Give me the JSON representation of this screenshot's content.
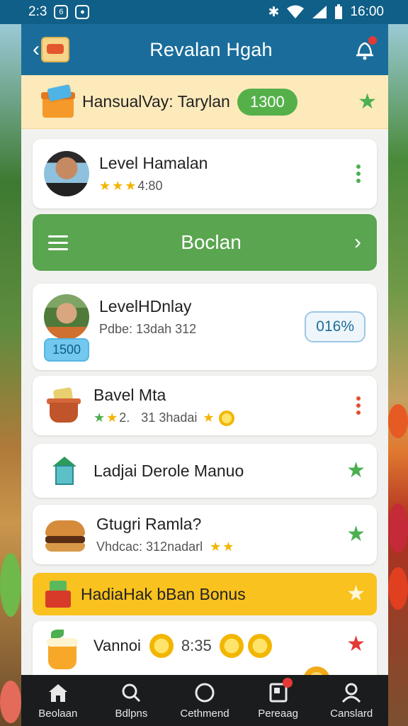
{
  "status_bar": {
    "left_text": "2:3",
    "time": "16:00"
  },
  "header": {
    "title": "Revalan Hgah"
  },
  "promo": {
    "text": "HansualVay: Tarylan",
    "pill": "1300"
  },
  "profile_card": {
    "title": "Level Hamalan",
    "sub": "4:80"
  },
  "primary_bar": {
    "label": "Boclan"
  },
  "level_card": {
    "title": "LevelHDnlay",
    "sub": "Pdbe: 13dah 312",
    "badge": "1500",
    "percent": "016%"
  },
  "rows": [
    {
      "title": "Bavel Mta",
      "sub_a": "2.",
      "sub_b": "31 3hadai"
    },
    {
      "title": "Ladjai Derole Manuo"
    },
    {
      "title": "Gtugri Ramla?",
      "sub": "Vhdcac: 312nadarl"
    }
  ],
  "bonus": {
    "label": "HadiaHak bBan Bonus"
  },
  "last_row": {
    "title": "Vannoi",
    "value": "8:35"
  },
  "bottom_nav": [
    {
      "label": "Beolaan",
      "icon": "home-icon"
    },
    {
      "label": "Bdlpns",
      "icon": "search-icon"
    },
    {
      "label": "Cethmend",
      "icon": "circle-icon"
    },
    {
      "label": "Pereaag",
      "icon": "inbox-icon"
    },
    {
      "label": "Canslard",
      "icon": "user-icon"
    }
  ],
  "colors": {
    "header": "#1a6d9b",
    "primary_green": "#5aa550",
    "bonus_yellow": "#f9c21e",
    "promo_bg": "#fdeabb"
  }
}
